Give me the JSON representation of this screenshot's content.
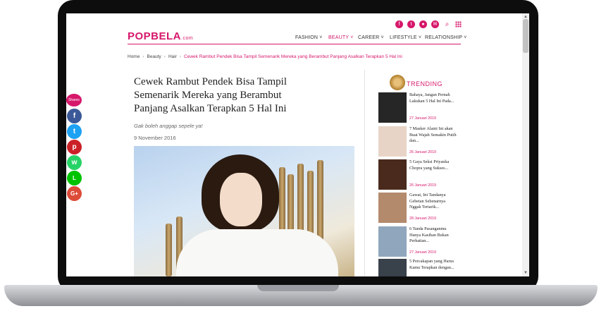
{
  "header": {
    "logo": "POPBELA",
    "logo_suffix": ".com",
    "social_icons": [
      "facebook-icon",
      "twitter-icon",
      "instagram-icon",
      "email-icon",
      "search-icon",
      "grid-menu-icon"
    ],
    "nav": [
      {
        "label": "FASHION ˅",
        "active": false
      },
      {
        "label": "BEAUTY ˅",
        "active": true
      },
      {
        "label": "CAREER ˅",
        "active": false
      },
      {
        "label": "LIFESTYLE ˅",
        "active": false
      },
      {
        "label": "RELATIONSHIP ˅",
        "active": false
      }
    ]
  },
  "breadcrumb": {
    "items": [
      "Home",
      "Beauty",
      "Hair"
    ],
    "current": "Cewek Rambut Pendek Bisa Tampil Semenarik Mereka yang Berambut Panjang Asalkan Terapkan 5 Hal Ini"
  },
  "article": {
    "title": "Cewek Rambut Pendek Bisa Tampil Semenarik Mereka yang Berambut Panjang Asalkan Terapkan 5 Hal Ini",
    "subtitle": "Gak boleh anggap sepele ya!",
    "date": "9 November 2016"
  },
  "share": {
    "label": "Shares",
    "buttons": [
      {
        "name": "facebook-share-button",
        "glyph": "f",
        "color": "#3b5998"
      },
      {
        "name": "twitter-share-button",
        "glyph": "t",
        "color": "#1da1f2"
      },
      {
        "name": "pinterest-share-button",
        "glyph": "p",
        "color": "#cb2027"
      },
      {
        "name": "whatsapp-share-button",
        "glyph": "w",
        "color": "#25d366"
      },
      {
        "name": "line-share-button",
        "glyph": "L",
        "color": "#00c300"
      },
      {
        "name": "google-plus-share-button",
        "glyph": "G+",
        "color": "#dd4b39"
      }
    ]
  },
  "trending": {
    "label": "TRENDING",
    "items": [
      {
        "title": "Bahaya, Jangan Pernah Lakukan 5 Hal Ini Pada...",
        "date": "27 Januari 2019",
        "thumb": "#262626"
      },
      {
        "title": "7 Masker Alami Ini akan Buat Wajah Semakin Putih dan...",
        "date": "26 Januari 2019",
        "thumb": "#e8d4c6"
      },
      {
        "title": "5 Gaya Seksi Priyanka Chopra yang Sukses...",
        "date": "26 Januari 2019",
        "thumb": "#4a2a1c"
      },
      {
        "title": "Gawat, Ini Tandanya Gebetan Sebenarnya Nggak Tertarik...",
        "date": "28 Januari 2019",
        "thumb": "#b48a6d"
      },
      {
        "title": "6 Tanda Pasanganmu Hanya Kasihan Bukan Perhatian...",
        "date": "27 Januari 2019",
        "thumb": "#8fa6bd"
      },
      {
        "title": "5 Percakapan yang Harus Kamu Terapkan dengan...",
        "date": "",
        "thumb": "#39414b"
      }
    ]
  },
  "colors": {
    "accent": "#d6186b"
  }
}
